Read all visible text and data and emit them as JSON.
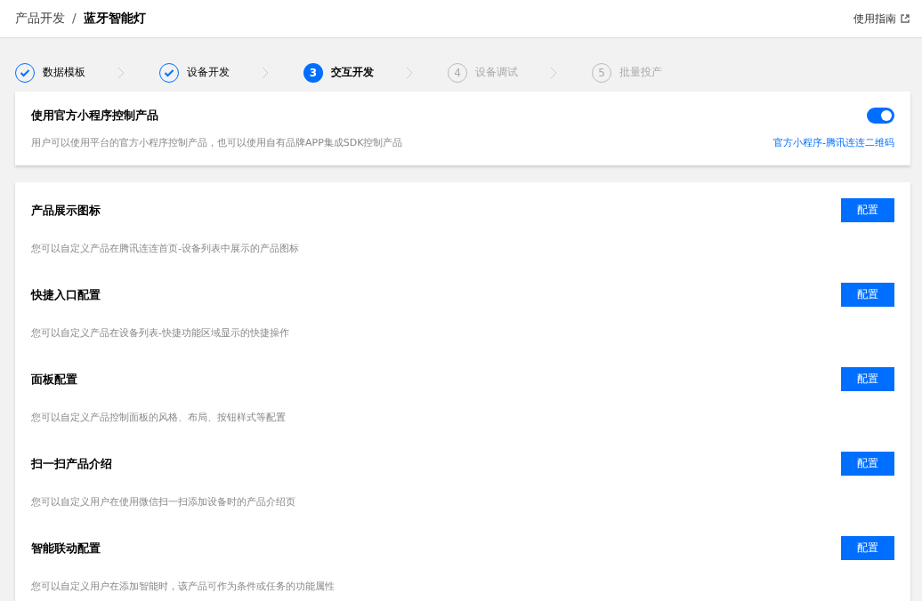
{
  "breadcrumb": {
    "parent": "产品开发",
    "separator": "/",
    "current": "蓝牙智能灯"
  },
  "guide_link": "使用指南",
  "steps": [
    {
      "kind": "done",
      "label": "数据模板"
    },
    {
      "kind": "done",
      "label": "设备开发"
    },
    {
      "kind": "current",
      "number": "3",
      "label": "交互开发"
    },
    {
      "kind": "pending",
      "number": "4",
      "label": "设备调试"
    },
    {
      "kind": "pending",
      "number": "5",
      "label": "批量投产"
    }
  ],
  "official_card": {
    "title": "使用官方小程序控制产品",
    "description": "用户可以使用平台的官方小程序控制产品，也可以使用自有品牌APP集成SDK控制产品",
    "toggle_on": true,
    "link": "官方小程序-腾讯连连二维码"
  },
  "config_sections": [
    {
      "title": "产品展示图标",
      "description": "您可以自定义产品在腾讯连连首页-设备列表中展示的产品图标",
      "button": "配置"
    },
    {
      "title": "快捷入口配置",
      "description": "您可以自定义产品在设备列表-快捷功能区域显示的快捷操作",
      "button": "配置"
    },
    {
      "title": "面板配置",
      "description": "您可以自定义产品控制面板的风格、布局、按钮样式等配置",
      "button": "配置"
    },
    {
      "title": "扫一扫产品介绍",
      "description": "您可以自定义用户在使用微信扫一扫添加设备时的产品介绍页",
      "button": "配置"
    },
    {
      "title": "智能联动配置",
      "description": "您可以自定义用户在添加智能时，该产品可作为条件或任务的功能属性",
      "button": "配置"
    }
  ]
}
